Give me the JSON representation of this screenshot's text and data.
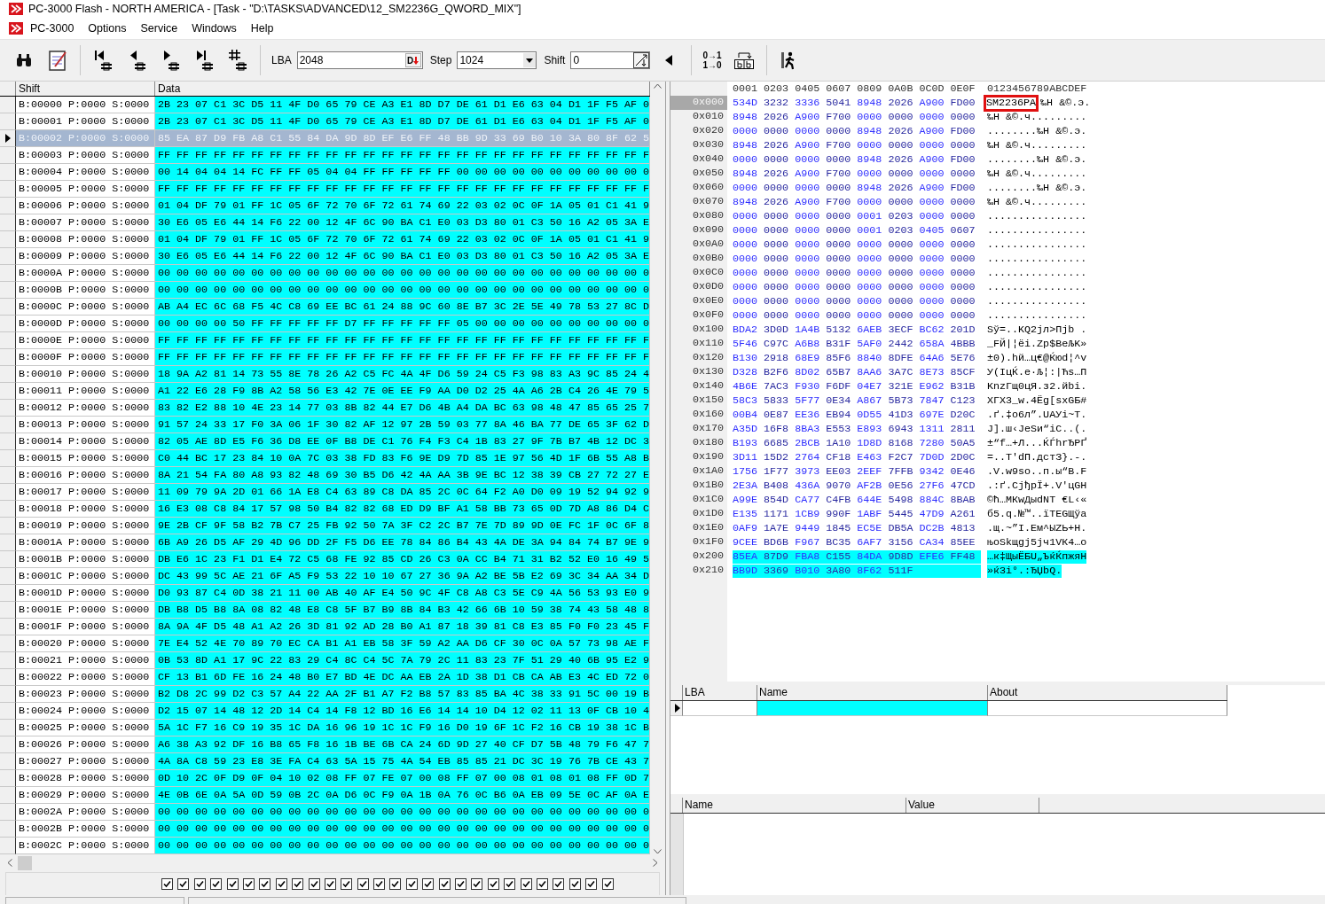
{
  "window": {
    "title": "PC-3000 Flash - NORTH AMERICA - [Task - \"D:\\TASKS\\ADVANCED\\12_SM2236G_QWORD_MIX\"]"
  },
  "menu": [
    "PC-3000",
    "Options",
    "Service",
    "Windows",
    "Help"
  ],
  "toolbar": {
    "lba": {
      "label": "LBA",
      "value": "2048",
      "button": "D"
    },
    "step": {
      "label": "Step",
      "value": "1024"
    },
    "shift": {
      "label": "Shift",
      "value": "0"
    },
    "swap_bits": [
      "0→1",
      "1→0"
    ]
  },
  "sector_table": {
    "columns": [
      "Shift",
      "Data"
    ],
    "rows": [
      {
        "shift": "B:00000 P:0000 S:0000",
        "data": "2B 23 07 C1 3C D5 11 4F D0 65 79 CE A3 E1 8D D7 DE 61 D1 E6 63 04 D1 1F F5 AF 0",
        "selected": false
      },
      {
        "shift": "B:00001 P:0000 S:0000",
        "data": "2B 23 07 C1 3C D5 11 4F D0 65 79 CE A3 E1 8D D7 DE 61 D1 E6 63 04 D1 1F F5 AF 0",
        "selected": false
      },
      {
        "shift": "B:00002 P:0000 S:0000",
        "data": "85 EA 87 D9 FB A8 C1 55 84 DA 9D 8D EF E6 FF 48 BB 9D 33 69 B0 10 3A 80 8F 62 5",
        "selected": true
      },
      {
        "shift": "B:00003 P:0000 S:0000",
        "data": "FF FF FF FF FF FF FF FF FF FF FF FF FF FF FF FF FF FF FF FF FF FF FF FF FF FF F",
        "selected": false
      },
      {
        "shift": "B:00004 P:0000 S:0000",
        "data": "00 14 04 04 14 FC FF FF 05 04 04 FF FF FF FF FF 00 00 00 00 00 00 00 00 00 00 0",
        "selected": false
      },
      {
        "shift": "B:00005 P:0000 S:0000",
        "data": "FF FF FF FF FF FF FF FF FF FF FF FF FF FF FF FF FF FF FF FF FF FF FF FF FF FF F",
        "selected": false
      },
      {
        "shift": "B:00006 P:0000 S:0000",
        "data": "01 04 DF 79 01 FF 1C 05 6F 72 70 6F 72 61 74 69 22 03 02 0C 0F 1A 05 01 C1 41 9",
        "selected": false
      },
      {
        "shift": "B:00007 P:0000 S:0000",
        "data": "30 E6 05 E6 44 14 F6 22 00 12 4F 6C 90 BA C1 E0 03 D3 80 01 C3 50 16 A2 05 3A E",
        "selected": false
      },
      {
        "shift": "B:00008 P:0000 S:0000",
        "data": "01 04 DF 79 01 FF 1C 05 6F 72 70 6F 72 61 74 69 22 03 02 0C 0F 1A 05 01 C1 41 9",
        "selected": false
      },
      {
        "shift": "B:00009 P:0000 S:0000",
        "data": "30 E6 05 E6 44 14 F6 22 00 12 4F 6C 90 BA C1 E0 03 D3 80 01 C3 50 16 A2 05 3A E",
        "selected": false
      },
      {
        "shift": "B:0000A P:0000 S:0000",
        "data": "00 00 00 00 00 00 00 00 00 00 00 00 00 00 00 00 00 00 00 00 00 00 00 00 00 00 0",
        "selected": false
      },
      {
        "shift": "B:0000B P:0000 S:0000",
        "data": "00 00 00 00 00 00 00 00 00 00 00 00 00 00 00 00 00 00 00 00 00 00 00 00 00 00 0",
        "selected": false
      },
      {
        "shift": "B:0000C P:0000 S:0000",
        "data": "AB A4 EC 6C 68 F5 4C C8 69 EE BC 61 24 88 9C 60 8E B7 3C 2E 5E 49 78 53 27 8C D",
        "selected": false
      },
      {
        "shift": "B:0000D P:0000 S:0000",
        "data": "00 00 00 00 50 FF FF FF FF FF D7 FF FF FF FF FF 05 00 00 00 00 00 00 00 00 00 0",
        "selected": false
      },
      {
        "shift": "B:0000E P:0000 S:0000",
        "data": "FF FF FF FF FF FF FF FF FF FF FF FF FF FF FF FF FF FF FF FF FF FF FF FF FF FF F",
        "selected": false
      },
      {
        "shift": "B:0000F P:0000 S:0000",
        "data": "FF FF FF FF FF FF FF FF FF FF FF FF FF FF FF FF FF FF FF FF FF FF FF FF FF FF F",
        "selected": false
      },
      {
        "shift": "B:00010 P:0000 S:0000",
        "data": "18 9A A2 81 14 73 55 8E 78 26 A2 C5 FC 4A 4F D6 59 24 C5 F3 98 83 A3 9C 85 24 4",
        "selected": false
      },
      {
        "shift": "B:00011 P:0000 S:0000",
        "data": "A1 22 E6 28 F9 8B A2 58 56 E3 42 7E 0E EE F9 AA D0 D2 25 4A A6 2B C4 26 4E 79 5",
        "selected": false
      },
      {
        "shift": "B:00012 P:0000 S:0000",
        "data": "83 82 E2 88 10 4E 23 14 77 03 8B 82 44 E7 D6 4B A4 DA BC 63 98 48 47 85 65 25 7",
        "selected": false
      },
      {
        "shift": "B:00013 P:0000 S:0000",
        "data": "91 57 24 33 17 F0 3A 06 1F 30 82 AF 12 97 2B 59 03 77 8A 46 BA 77 DE 65 3F 62 D",
        "selected": false
      },
      {
        "shift": "B:00014 P:0000 S:0000",
        "data": "82 05 AE 8D E5 F6 36 D8 EE 0F B8 DE C1 76 F4 F3 C4 1B 83 27 9F 7B B7 4B 12 DC 3",
        "selected": false
      },
      {
        "shift": "B:00015 P:0000 S:0000",
        "data": "C0 44 BC 17 23 84 10 0A 7C 03 38 FD 83 F6 9E D9 7D 85 1E 97 56 4D 1F 6B 55 A8 B",
        "selected": false
      },
      {
        "shift": "B:00016 P:0000 S:0000",
        "data": "8A 21 54 FA 80 A8 93 82 48 69 30 B5 D6 42 4A AA 3B 9E BC 12 38 39 CB 27 72 27 E",
        "selected": false
      },
      {
        "shift": "B:00017 P:0000 S:0000",
        "data": "11 09 79 9A 2D 01 66 1A E8 C4 63 89 C8 DA 85 2C 0C 64 F2 A0 D0 09 19 52 94 92 9",
        "selected": false
      },
      {
        "shift": "B:00018 P:0000 S:0000",
        "data": "16 E3 08 C8 84 17 57 98 50 B4 82 82 68 ED D9 BF A1 58 BB 73 65 0D 7D A8 86 D4 C",
        "selected": false
      },
      {
        "shift": "B:00019 P:0000 S:0000",
        "data": "9E 2B CF 9F 58 B2 7B C7 25 FB 92 50 7A 3F C2 2C B7 7E 7D 89 9D 0E FC 1F 0C 6F 8",
        "selected": false
      },
      {
        "shift": "B:0001A P:0000 S:0000",
        "data": "6B A9 26 D5 AF 29 4D 96 DD 2F F5 D6 EE 78 84 86 B4 43 4A DE 3A 94 84 74 B7 9E 9",
        "selected": false
      },
      {
        "shift": "B:0001B P:0000 S:0000",
        "data": "DB E6 1C 23 F1 D1 E4 72 C5 68 FE 92 85 CD 26 C3 0A CC B4 71 31 B2 52 E0 16 49 5",
        "selected": false
      },
      {
        "shift": "B:0001C P:0000 S:0000",
        "data": "DC 43 99 5C AE 21 6F A5 F9 53 22 10 10 67 27 36 9A A2 BE 5B E2 69 3C 34 AA 34 D",
        "selected": false
      },
      {
        "shift": "B:0001D P:0000 S:0000",
        "data": "D0 93 87 C4 0D 38 21 11 00 AB 40 AF E4 50 9C 4F C8 A8 C3 5E C9 4A 56 53 93 E0 9",
        "selected": false
      },
      {
        "shift": "B:0001E P:0000 S:0000",
        "data": "DB B8 D5 B8 8A 08 82 48 E8 C8 5F B7 B9 8B 84 B3 42 66 6B 10 59 38 74 43 58 48 8",
        "selected": false
      },
      {
        "shift": "B:0001F P:0000 S:0000",
        "data": "8A 9A 4F D5 48 A1 A2 26 3D 81 92 AD 28 B0 A1 87 18 39 81 C8 E3 85 F0 F0 23 45 F",
        "selected": false
      },
      {
        "shift": "B:00020 P:0000 S:0000",
        "data": "7E E4 52 4E 70 89 70 EC CA B1 A1 EB 58 3F 59 A2 AA D6 CF 30 0C 0A 57 73 98 AE F",
        "selected": false
      },
      {
        "shift": "B:00021 P:0000 S:0000",
        "data": "0B 53 8D A1 17 9C 22 83 29 C4 8C C4 5C 7A 79 2C 11 83 23 7F 51 29 40 6B 95 E2 9",
        "selected": false
      },
      {
        "shift": "B:00022 P:0000 S:0000",
        "data": "CF 13 B1 6D FE 16 24 48 B0 E7 BD 4E DC AA EB 2A 1D 38 D1 CB CA AB E3 4C ED 72 0",
        "selected": false
      },
      {
        "shift": "B:00023 P:0000 S:0000",
        "data": "B2 D8 2C 99 D2 C3 57 A4 22 AA 2F B1 A7 F2 B8 57 83 85 BA 4C 38 33 91 5C 00 19 B",
        "selected": false
      },
      {
        "shift": "B:00024 P:0000 S:0000",
        "data": "D2 15 07 14 48 12 2D 14 C4 14 F8 12 BD 16 E6 14 14 10 D4 12 02 11 13 0F CB 10 4",
        "selected": false
      },
      {
        "shift": "B:00025 P:0000 S:0000",
        "data": "5A 1C F7 16 C9 19 35 1C DA 16 96 19 1C 1C F9 16 D0 19 6F 1C F2 16 CB 19 38 1C B",
        "selected": false
      },
      {
        "shift": "B:00026 P:0000 S:0000",
        "data": "A6 38 A3 92 DF 16 B8 65 F8 16 1B BE 6B CA 24 6D 9D 27 40 CF D7 5B 48 79 F6 47 7",
        "selected": false
      },
      {
        "shift": "B:00027 P:0000 S:0000",
        "data": "4A 8A C8 59 23 E8 3E FA C4 63 5A 15 75 4A 54 EB 85 85 21 DC 3C 19 76 7B CE 43 7",
        "selected": false
      },
      {
        "shift": "B:00028 P:0000 S:0000",
        "data": "0D 10 2C 0F D9 0F 04 10 02 08 FF 07 FE 07 00 08 FF 07 00 08 01 08 01 08 FF 0D 7",
        "selected": false
      },
      {
        "shift": "B:00029 P:0000 S:0000",
        "data": "4E 0B 6E 0A 5A 0D 59 0B 2C 0A D6 0C F9 0A 1B 0A 76 0C B6 0A EB 09 5E 0C AF 0A E",
        "selected": false
      },
      {
        "shift": "B:0002A P:0000 S:0000",
        "data": "00 00 00 00 00 00 00 00 00 00 00 00 00 00 00 00 00 00 00 00 00 00 00 00 00 00 0",
        "selected": false
      },
      {
        "shift": "B:0002B P:0000 S:0000",
        "data": "00 00 00 00 00 00 00 00 00 00 00 00 00 00 00 00 00 00 00 00 00 00 00 00 00 00 0",
        "selected": false
      },
      {
        "shift": "B:0002C P:0000 S:0000",
        "data": "00 00 00 00 00 00 00 00 00 00 00 00 00 00 00 00 00 00 00 00 00 00 00 00 00 00 0",
        "selected": false
      }
    ]
  },
  "checkboxes": [
    {
      "checked": true
    },
    {
      "checked": true
    },
    {
      "checked": true
    },
    {
      "checked": true
    },
    {
      "checked": true
    },
    {
      "checked": true
    },
    {
      "checked": true
    },
    {
      "checked": true
    },
    {
      "checked": true
    },
    {
      "checked": true
    },
    {
      "checked": true
    },
    {
      "checked": true
    },
    {
      "checked": true
    },
    {
      "checked": true
    },
    {
      "checked": true
    },
    {
      "checked": true
    },
    {
      "checked": true
    },
    {
      "checked": true
    },
    {
      "checked": true
    },
    {
      "checked": true
    },
    {
      "checked": true
    },
    {
      "checked": true
    },
    {
      "checked": true
    },
    {
      "checked": true
    },
    {
      "checked": true
    },
    {
      "checked": true
    },
    {
      "checked": true
    },
    {
      "checked": true
    }
  ],
  "hex_view": {
    "header_words": [
      "0001",
      "0203",
      "0405",
      "0607",
      "0809",
      "0A0B",
      "0C0D",
      "0E0F"
    ],
    "header_ascii": "0123456789ABCDEF",
    "rows": [
      {
        "offset": "0x000",
        "words": [
          "534D",
          "3232",
          "3336",
          "5041",
          "8948",
          "2026",
          "A900",
          "FD00"
        ],
        "ascii_boxed": "SM2236PA",
        "ascii": "‰H &©.э.",
        "current": true,
        "selected": false
      },
      {
        "offset": "0x010",
        "words": [
          "8948",
          "2026",
          "A900",
          "F700",
          "0000",
          "0000",
          "0000",
          "0000"
        ],
        "ascii": "‰H &©.ч.........",
        "current": false,
        "selected": false
      },
      {
        "offset": "0x020",
        "words": [
          "0000",
          "0000",
          "0000",
          "0000",
          "8948",
          "2026",
          "A900",
          "FD00"
        ],
        "ascii": "........‰H &©.э.",
        "current": false,
        "selected": false
      },
      {
        "offset": "0x030",
        "words": [
          "8948",
          "2026",
          "A900",
          "F700",
          "0000",
          "0000",
          "0000",
          "0000"
        ],
        "ascii": "‰H &©.ч.........",
        "current": false,
        "selected": false
      },
      {
        "offset": "0x040",
        "words": [
          "0000",
          "0000",
          "0000",
          "0000",
          "8948",
          "2026",
          "A900",
          "FD00"
        ],
        "ascii": "........‰H &©.э.",
        "current": false,
        "selected": false
      },
      {
        "offset": "0x050",
        "words": [
          "8948",
          "2026",
          "A900",
          "F700",
          "0000",
          "0000",
          "0000",
          "0000"
        ],
        "ascii": "‰H &©.ч.........",
        "current": false,
        "selected": false
      },
      {
        "offset": "0x060",
        "words": [
          "0000",
          "0000",
          "0000",
          "0000",
          "8948",
          "2026",
          "A900",
          "FD00"
        ],
        "ascii": "........‰H &©.э.",
        "current": false,
        "selected": false
      },
      {
        "offset": "0x070",
        "words": [
          "8948",
          "2026",
          "A900",
          "F700",
          "0000",
          "0000",
          "0000",
          "0000"
        ],
        "ascii": "‰H &©.ч.........",
        "current": false,
        "selected": false
      },
      {
        "offset": "0x080",
        "words": [
          "0000",
          "0000",
          "0000",
          "0000",
          "0001",
          "0203",
          "0000",
          "0000"
        ],
        "ascii": "................",
        "current": false,
        "selected": false
      },
      {
        "offset": "0x090",
        "words": [
          "0000",
          "0000",
          "0000",
          "0000",
          "0001",
          "0203",
          "0405",
          "0607"
        ],
        "ascii": "................",
        "current": false,
        "selected": false
      },
      {
        "offset": "0x0A0",
        "words": [
          "0000",
          "0000",
          "0000",
          "0000",
          "0000",
          "0000",
          "0000",
          "0000"
        ],
        "ascii": "................",
        "current": false,
        "selected": false
      },
      {
        "offset": "0x0B0",
        "words": [
          "0000",
          "0000",
          "0000",
          "0000",
          "0000",
          "0000",
          "0000",
          "0000"
        ],
        "ascii": "................",
        "current": false,
        "selected": false
      },
      {
        "offset": "0x0C0",
        "words": [
          "0000",
          "0000",
          "0000",
          "0000",
          "0000",
          "0000",
          "0000",
          "0000"
        ],
        "ascii": "................",
        "current": false,
        "selected": false
      },
      {
        "offset": "0x0D0",
        "words": [
          "0000",
          "0000",
          "0000",
          "0000",
          "0000",
          "0000",
          "0000",
          "0000"
        ],
        "ascii": "................",
        "current": false,
        "selected": false
      },
      {
        "offset": "0x0E0",
        "words": [
          "0000",
          "0000",
          "0000",
          "0000",
          "0000",
          "0000",
          "0000",
          "0000"
        ],
        "ascii": "................",
        "current": false,
        "selected": false
      },
      {
        "offset": "0x0F0",
        "words": [
          "0000",
          "0000",
          "0000",
          "0000",
          "0000",
          "0000",
          "0000",
          "0000"
        ],
        "ascii": "................",
        "current": false,
        "selected": false
      },
      {
        "offset": "0x100",
        "words": [
          "BDA2",
          "3D0D",
          "1A4B",
          "5132",
          "6AEB",
          "3ECF",
          "BC62",
          "201D"
        ],
        "ascii": "Ѕў=..KQ2jл>Пjb .",
        "current": false,
        "selected": false
      },
      {
        "offset": "0x110",
        "words": [
          "5F46",
          "C97C",
          "A6B8",
          "B31F",
          "5AF0",
          "2442",
          "658A",
          "4BBB"
        ],
        "ascii": "_FЙ|¦ёі.Zр$BeЉK»",
        "current": false,
        "selected": false
      },
      {
        "offset": "0x120",
        "words": [
          "B130",
          "2918",
          "68E9",
          "85F6",
          "8840",
          "8DFE",
          "64A6",
          "5E76"
        ],
        "ascii": "±0).hй…ц€@Ќюd¦^v",
        "current": false,
        "selected": false
      },
      {
        "offset": "0x130",
        "words": [
          "D328",
          "B2F6",
          "8D02",
          "65B7",
          "8AA6",
          "3A7C",
          "8E73",
          "85CF"
        ],
        "ascii": "У(ІцЌ.e·Љ¦:|Ћs…П",
        "current": false,
        "selected": false
      },
      {
        "offset": "0x140",
        "words": [
          "4B6E",
          "7AC3",
          "F930",
          "F6DF",
          "04E7",
          "321E",
          "E962",
          "B31B"
        ],
        "ascii": "KnzГщ0цЯ.з2.йbі.",
        "current": false,
        "selected": false
      },
      {
        "offset": "0x150",
        "words": [
          "58C3",
          "5833",
          "5F77",
          "0E34",
          "A867",
          "5B73",
          "7847",
          "C123"
        ],
        "ascii": "XГX3_w.4Ёg[sxGБ#",
        "current": false,
        "selected": false
      },
      {
        "offset": "0x160",
        "words": [
          "00B4",
          "0E87",
          "EE36",
          "EB94",
          "0D55",
          "41D3",
          "697E",
          "D20C"
        ],
        "ascii": ".ґ.‡о6л”.UAУi~Т.",
        "current": false,
        "selected": false
      },
      {
        "offset": "0x170",
        "words": [
          "A35D",
          "16F8",
          "8BA3",
          "E553",
          "E893",
          "6943",
          "1311",
          "2811"
        ],
        "ascii": "Ј].ш‹ЈеSи“iC..(.",
        "current": false,
        "selected": false
      },
      {
        "offset": "0x180",
        "words": [
          "B193",
          "6685",
          "2BCB",
          "1A10",
          "1D8D",
          "8168",
          "7280",
          "50A5"
        ],
        "ascii": "±“f…+Л...ЌЃhrЂPҐ",
        "current": false,
        "selected": false
      },
      {
        "offset": "0x190",
        "words": [
          "3D11",
          "15D2",
          "2764",
          "CF18",
          "E463",
          "F2C7",
          "7D0D",
          "2D0C"
        ],
        "ascii": "=..Т'dП.дcтЗ}.-.",
        "current": false,
        "selected": false
      },
      {
        "offset": "0x1A0",
        "words": [
          "1756",
          "1F77",
          "3973",
          "EE03",
          "2EEF",
          "7FFB",
          "9342",
          "0E46"
        ],
        "ascii": ".V.w9sо..п.ы“B.F",
        "current": false,
        "selected": false
      },
      {
        "offset": "0x1B0",
        "words": [
          "2E3A",
          "B408",
          "436A",
          "9070",
          "AF2B",
          "0E56",
          "27F6",
          "47CD"
        ],
        "ascii": ".:ґ.CjђpЇ+.V'цGН",
        "current": false,
        "selected": false
      },
      {
        "offset": "0x1C0",
        "words": [
          "A99E",
          "854D",
          "CA77",
          "C4FB",
          "644E",
          "5498",
          "884C",
          "8BAB"
        ],
        "ascii": "©ћ…MКwДыdNT €L‹«",
        "current": false,
        "selected": false
      },
      {
        "offset": "0x1D0",
        "words": [
          "E135",
          "1171",
          "1CB9",
          "990F",
          "1ABF",
          "5445",
          "47D9",
          "A261"
        ],
        "ascii": "б5.q.№™..їTEGЩўa",
        "current": false,
        "selected": false
      },
      {
        "offset": "0x1E0",
        "words": [
          "0AF9",
          "1A7E",
          "9449",
          "1845",
          "EC5E",
          "DB5A",
          "DC2B",
          "4813"
        ],
        "ascii": ".щ.~”I.Eм^ЫZЬ+H.",
        "current": false,
        "selected": false
      },
      {
        "offset": "0x1F0",
        "words": [
          "9CEE",
          "BD6B",
          "F967",
          "BC35",
          "6AF7",
          "3156",
          "CA34",
          "85EE"
        ],
        "ascii": "њоЅkщgј5jч1VК4…о",
        "current": false,
        "selected": false
      },
      {
        "offset": "0x200",
        "words": [
          "85EA",
          "87D9",
          "FBA8",
          "C155",
          "84DA",
          "9D8D",
          "EFE6",
          "FF48"
        ],
        "ascii": "…к‡ЩыЁБU„ЪќЌпжяH",
        "current": false,
        "selected": true
      },
      {
        "offset": "0x210",
        "words": [
          "BB9D",
          "3369",
          "B010",
          "3A80",
          "8F62",
          "511F"
        ],
        "ascii": "»ќ3i°.:ЂЏbQ.",
        "current": false,
        "selected": true
      }
    ]
  },
  "bookmarks": {
    "columns": [
      "LBA",
      "Name",
      "About"
    ]
  },
  "properties": {
    "columns": [
      "Name",
      "Value"
    ]
  }
}
